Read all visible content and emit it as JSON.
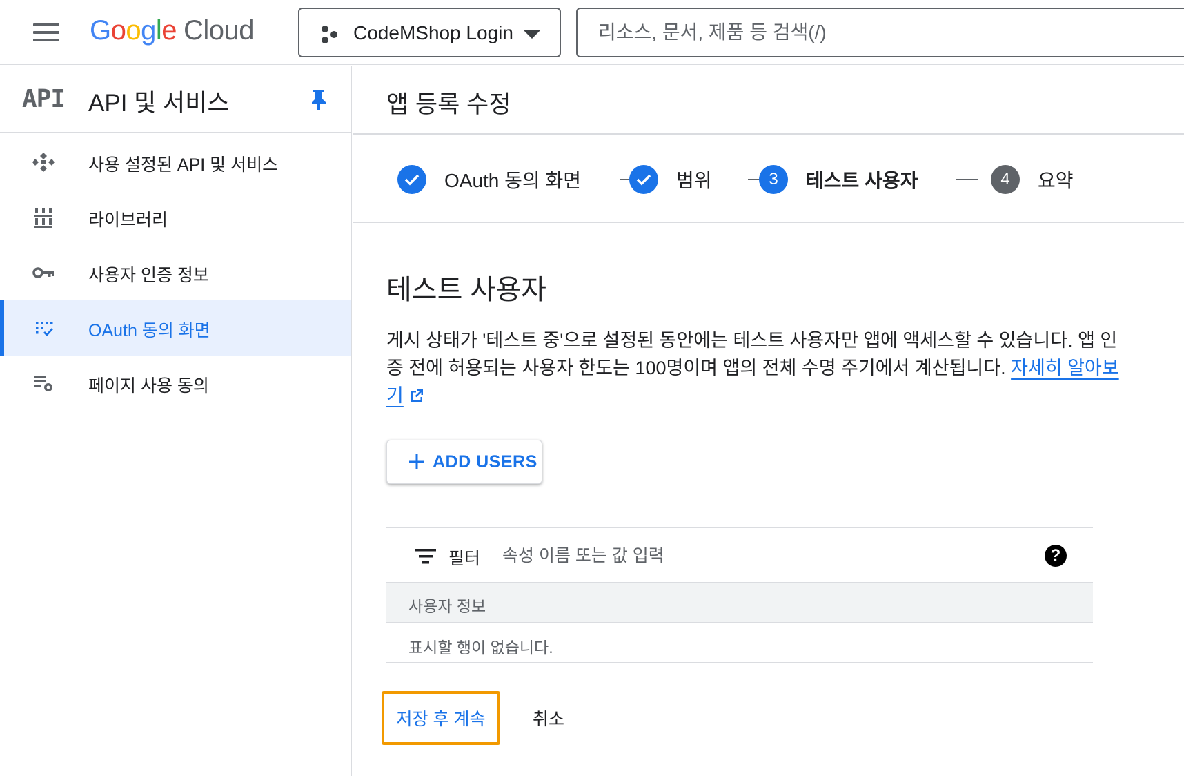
{
  "topbar": {
    "logo_letters": [
      "G",
      "o",
      "o",
      "g",
      "l",
      "e"
    ],
    "logo_product": "Cloud",
    "project_name": "CodeMShop Login",
    "search_placeholder": "리소스, 문서, 제품 등 검색(/)"
  },
  "sidebar": {
    "logo_text": "API",
    "title": "API 및 서비스",
    "items": [
      {
        "label": "사용 설정된 API 및 서비스",
        "icon": "apis-icon",
        "active": false
      },
      {
        "label": "라이브러리",
        "icon": "library-icon",
        "active": false
      },
      {
        "label": "사용자 인증 정보",
        "icon": "key-icon",
        "active": false
      },
      {
        "label": "OAuth 동의 화면",
        "icon": "oauth-consent-icon",
        "active": true
      },
      {
        "label": "페이지 사용 동의",
        "icon": "page-usage-settings-icon",
        "active": false
      }
    ]
  },
  "main": {
    "page_title": "앱 등록 수정",
    "steps": [
      {
        "number": "✓",
        "label": "OAuth 동의 화면",
        "state": "done"
      },
      {
        "number": "✓",
        "label": "범위",
        "state": "done"
      },
      {
        "number": "3",
        "label": "테스트 사용자",
        "state": "current"
      },
      {
        "number": "4",
        "label": "요약",
        "state": "future"
      }
    ],
    "section_title": "테스트 사용자",
    "description": "게시 상태가 '테스트 중'으로 설정된 동안에는 테스트 사용자만 앱에 액세스할 수 있습니다. 앱 인증 전에 허용되는 사용자 한도는 100명이며 앱의 전체 수명 주기에서 계산됩니다.",
    "learn_more": "자세히 알아보기",
    "add_users_label": "ADD USERS",
    "filter": {
      "label": "필터",
      "placeholder": "속성 이름 또는 값 입력",
      "help": "?"
    },
    "table": {
      "column_header": "사용자 정보",
      "empty_text": "표시할 행이 없습니다."
    },
    "save_label": "저장 후 계속",
    "cancel_label": "취소"
  },
  "colors": {
    "accent": "#1a73e8",
    "highlight_border": "#f29900",
    "active_nav_bg": "#e8f0fe"
  }
}
